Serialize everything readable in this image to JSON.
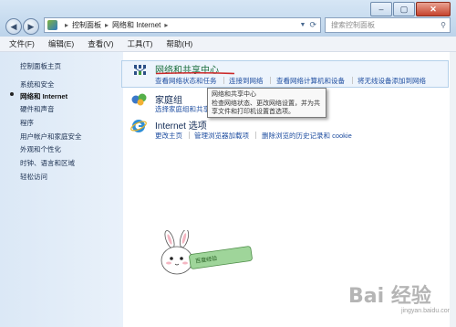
{
  "window": {
    "controls": [
      "–",
      "▢",
      "✕"
    ]
  },
  "toolbar": {
    "back_glyph": "◀",
    "forward_glyph": "▶",
    "breadcrumb": [
      "控制面板",
      "网络和 Internet"
    ],
    "breadcrumb_sep": "▸",
    "search_placeholder": "搜索控制面板"
  },
  "menu": {
    "items": [
      "文件(F)",
      "编辑(E)",
      "查看(V)",
      "工具(T)",
      "帮助(H)"
    ]
  },
  "sidebar": {
    "items": [
      {
        "label": "控制面板主页",
        "active": false
      },
      {
        "label": "系统和安全",
        "active": false
      },
      {
        "label": "网络和 Internet",
        "active": true
      },
      {
        "label": "硬件和声音",
        "active": false
      },
      {
        "label": "程序",
        "active": false
      },
      {
        "label": "用户帐户和家庭安全",
        "active": false
      },
      {
        "label": "外观和个性化",
        "active": false
      },
      {
        "label": "时钟、语言和区域",
        "active": false
      },
      {
        "label": "轻松访问",
        "active": false
      }
    ]
  },
  "categories": {
    "network": {
      "title": "网络和共享中心",
      "icon": "network-sharing-icon",
      "links": [
        "查看网络状态和任务",
        "连接到网络",
        "查看网络计算机和设备",
        "将无线设备添加到网络"
      ]
    },
    "homegroup": {
      "title": "家庭组",
      "icon": "homegroup-icon",
      "links": [
        "选择家庭组和共享选项"
      ]
    },
    "internet": {
      "title": "Internet 选项",
      "icon": "internet-explorer-icon",
      "links": [
        "更改主页",
        "管理浏览器加载项",
        "删除浏览的历史记录和 cookie"
      ]
    }
  },
  "tooltip": {
    "title": "网络和共享中心",
    "body": "检查网络状态、更改网络设置，并为共享文件和打印机设置首选项。"
  },
  "mascot": {
    "text": "百度经验"
  },
  "watermark": {
    "text": "Bai 经验",
    "sub": "jingyan.baidu.com"
  },
  "colors": {
    "link": "#1f4ea0",
    "category_title": "#1c6f3e",
    "highlight_underline": "#cc2a2a"
  }
}
